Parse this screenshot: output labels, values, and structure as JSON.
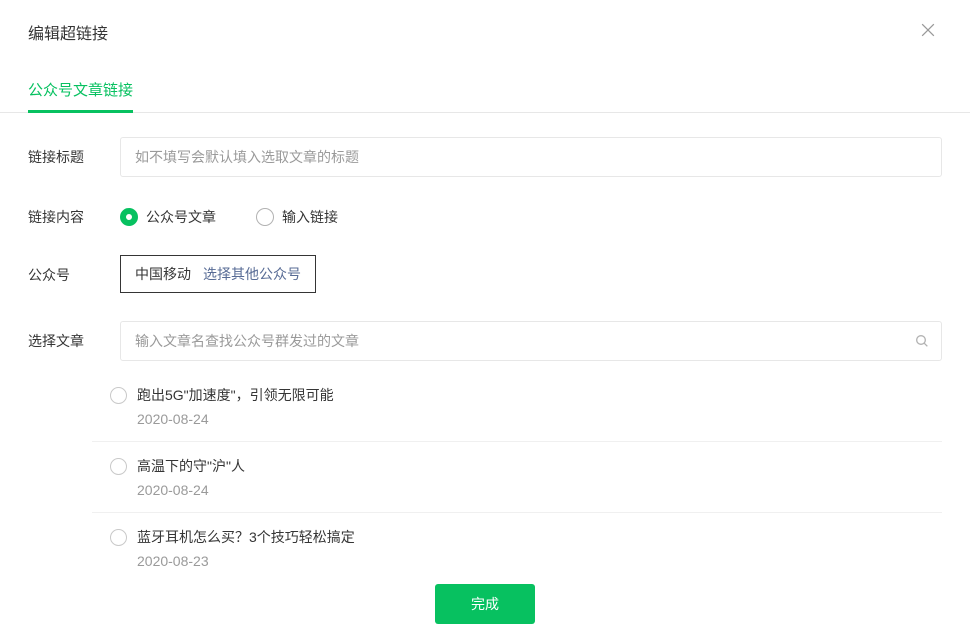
{
  "dialog": {
    "title": "编辑超链接"
  },
  "tabs": {
    "active": "公众号文章链接"
  },
  "form": {
    "link_title": {
      "label": "链接标题",
      "placeholder": "如不填写会默认填入选取文章的标题",
      "value": ""
    },
    "link_content": {
      "label": "链接内容",
      "options": {
        "article": "公众号文章",
        "url": "输入链接"
      }
    },
    "account": {
      "label": "公众号",
      "name": "中国移动",
      "switch_link": "选择其他公众号"
    },
    "select_article": {
      "label": "选择文章",
      "placeholder": "输入文章名查找公众号群发过的文章"
    }
  },
  "articles": [
    {
      "title": "跑出5G\"加速度\"，引领无限可能",
      "date": "2020-08-24"
    },
    {
      "title": "高温下的守\"沪\"人",
      "date": "2020-08-24"
    },
    {
      "title": "蓝牙耳机怎么买？3个技巧轻松搞定",
      "date": "2020-08-23"
    }
  ],
  "footer": {
    "submit": "完成"
  }
}
